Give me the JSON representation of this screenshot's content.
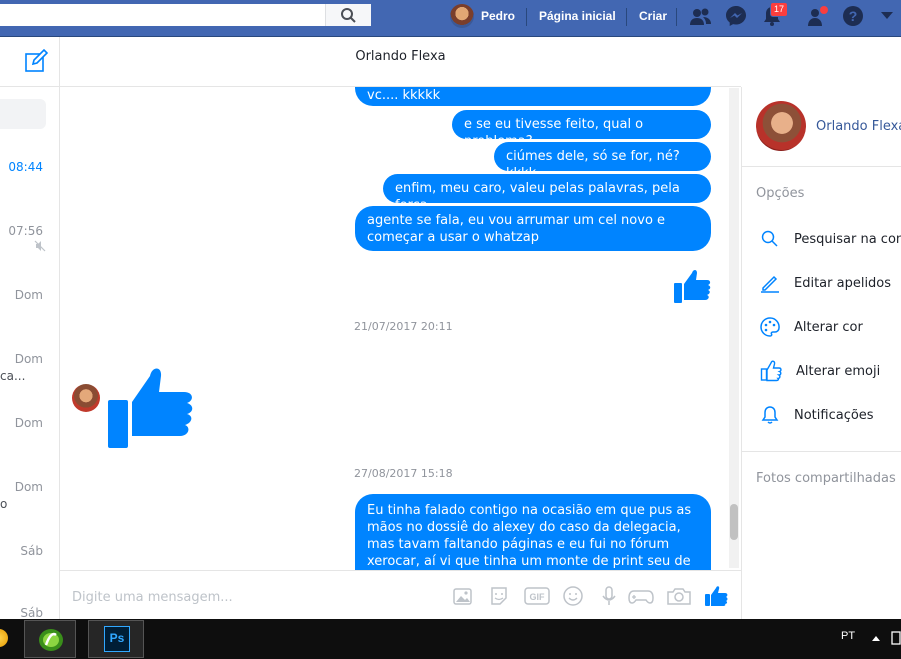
{
  "topbar": {
    "search_placeholder": "",
    "user_name": "Pedro",
    "home_label": "Página inicial",
    "create_label": "Criar",
    "notifications_count": "17"
  },
  "sidebar": {
    "times": [
      "08:44",
      "07:56",
      "Dom",
      "Dom",
      "Dom",
      "Dom",
      "Sáb",
      "Sáb"
    ],
    "snippets": [
      "ca...",
      "o"
    ]
  },
  "conversation": {
    "title": "Orlando Flexa",
    "messages": [
      {
        "text": "vc.... kkkkk"
      },
      {
        "text": "e se eu tivesse feito, qual o problema?"
      },
      {
        "text": "ciúmes dele, só se for, né? kkkk"
      },
      {
        "text": "enfim, meu caro, valeu pelas palavras, pela força.."
      },
      {
        "text": "agente se fala, eu vou arrumar um cel novo e começar a usar o whatzap"
      },
      {
        "text": "Eu tinha falado contigo na ocasião em que pus as mãos no dossiê do alexey do caso da delegacia, mas tavam faltando páginas e eu fui no fórum xerocar, aí vi que tinha um monte de print seu de uma conversa"
      }
    ],
    "timestamps": [
      "21/07/2017 20:11",
      "27/08/2017 15:18"
    ]
  },
  "composer": {
    "placeholder": "Digite uma mensagem..."
  },
  "right_panel": {
    "contact_name": "Orlando Flexa",
    "options_label": "Opções",
    "options": [
      {
        "label": "Pesquisar na conversa",
        "icon": "search-icon"
      },
      {
        "label": "Editar apelidos",
        "icon": "pencil-icon"
      },
      {
        "label": "Alterar cor",
        "icon": "palette-icon"
      },
      {
        "label": "Alterar emoji",
        "icon": "thumbs-up-icon"
      },
      {
        "label": "Notificações",
        "icon": "bell-icon"
      }
    ],
    "shared_photos_label": "Fotos compartilhadas"
  },
  "taskbar": {
    "language": "PT"
  },
  "colors": {
    "facebook_blue": "#4267b2",
    "messenger_blue": "#0084ff"
  }
}
